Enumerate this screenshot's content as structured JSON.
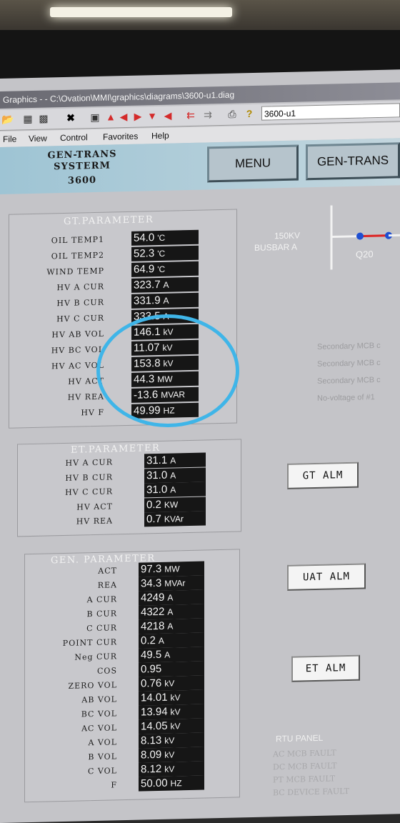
{
  "window": {
    "title": "Graphics - - C:\\Ovation\\MMI\\graphics\\diagrams\\3600-u1.diag",
    "toolbar_field": "3600-u1"
  },
  "menu": [
    "File",
    "View",
    "Control",
    "Favorites",
    "Help"
  ],
  "header": {
    "title_line1": "GEN-TRANS",
    "title_line2": "SYSTERM",
    "title_line3": "3600",
    "menu_button": "MENU",
    "gen_trans_button": "GEN-TRANS"
  },
  "gt_parameter": {
    "title": "GT.PARAMETER",
    "rows": [
      {
        "label": "OIL TEMP1",
        "value": "54.0",
        "unit": "'C"
      },
      {
        "label": "OIL TEMP2",
        "value": "52.3",
        "unit": "'C"
      },
      {
        "label": "WIND TEMP",
        "value": "64.9",
        "unit": "'C"
      },
      {
        "label": "HV A CUR",
        "value": "323.7",
        "unit": "A"
      },
      {
        "label": "HV B CUR",
        "value": "331.9",
        "unit": "A"
      },
      {
        "label": "HV C CUR",
        "value": "333.5",
        "unit": "A"
      },
      {
        "label": "HV AB VOL",
        "value": "146.1",
        "unit": "kV"
      },
      {
        "label": "HV BC VOL",
        "value": "11.07",
        "unit": "kV"
      },
      {
        "label": "HV AC VOL",
        "value": "153.8",
        "unit": "kV"
      },
      {
        "label": "HV ACT",
        "value": "44.3",
        "unit": "MW"
      },
      {
        "label": "HV REA",
        "value": "-13.6",
        "unit": "MVAR"
      },
      {
        "label": "HV F",
        "value": "49.99",
        "unit": "HZ"
      }
    ]
  },
  "et_parameter": {
    "title": "ET.PARAMETER",
    "rows": [
      {
        "label": "HV A CUR",
        "value": "31.1",
        "unit": "A"
      },
      {
        "label": "HV B CUR",
        "value": "31.0",
        "unit": "A"
      },
      {
        "label": "HV C CUR",
        "value": "31.0",
        "unit": "A"
      },
      {
        "label": "HV ACT",
        "value": "0.2",
        "unit": "KW"
      },
      {
        "label": "HV REA",
        "value": "0.7",
        "unit": "KVAr"
      }
    ]
  },
  "gen_parameter": {
    "title": "GEN. PARAMETER",
    "rows": [
      {
        "label": "ACT",
        "value": "97.3",
        "unit": "MW"
      },
      {
        "label": "REA",
        "value": "34.3",
        "unit": "MVAr"
      },
      {
        "label": "A CUR",
        "value": "4249",
        "unit": "A"
      },
      {
        "label": "B CUR",
        "value": "4322",
        "unit": "A"
      },
      {
        "label": "C CUR",
        "value": "4218",
        "unit": "A"
      },
      {
        "label": "POINT CUR",
        "value": "0.2",
        "unit": "A"
      },
      {
        "label": "Neg CUR",
        "value": "49.5",
        "unit": "A"
      },
      {
        "label": "COS",
        "value": "0.95",
        "unit": ""
      },
      {
        "label": "ZERO VOL",
        "value": "0.76",
        "unit": "kV"
      },
      {
        "label": "AB VOL",
        "value": "14.01",
        "unit": "kV"
      },
      {
        "label": "BC VOL",
        "value": "13.94",
        "unit": "kV"
      },
      {
        "label": "AC VOL",
        "value": "14.05",
        "unit": "kV"
      },
      {
        "label": "A VOL",
        "value": "8.13",
        "unit": "kV"
      },
      {
        "label": "B VOL",
        "value": "8.09",
        "unit": "kV"
      },
      {
        "label": "C VOL",
        "value": "8.12",
        "unit": "kV"
      },
      {
        "label": "F",
        "value": "50.00",
        "unit": "HZ"
      }
    ]
  },
  "busbar": {
    "label_line1": "150KV",
    "label_line2": "BUSBAR A",
    "breaker": "Q20"
  },
  "alarms": {
    "gt": "GT ALM",
    "uat": "UAT ALM",
    "et": "ET ALM"
  },
  "secondary_status": [
    "Secondary MCB c",
    "Secondary MCB c",
    "Secondary MCB c",
    "No-voltage of #1"
  ],
  "rtu_panel": {
    "title": "RTU PANEL",
    "items": [
      "AC MCB FAULT",
      "DC MCB FAULT",
      "PT MCB FAULT",
      "BC DEVICE FAULT"
    ]
  },
  "colors": {
    "highlight_circle": "#3fb5e8",
    "value_background": "#161616",
    "header_background": "#9ec4d4"
  }
}
